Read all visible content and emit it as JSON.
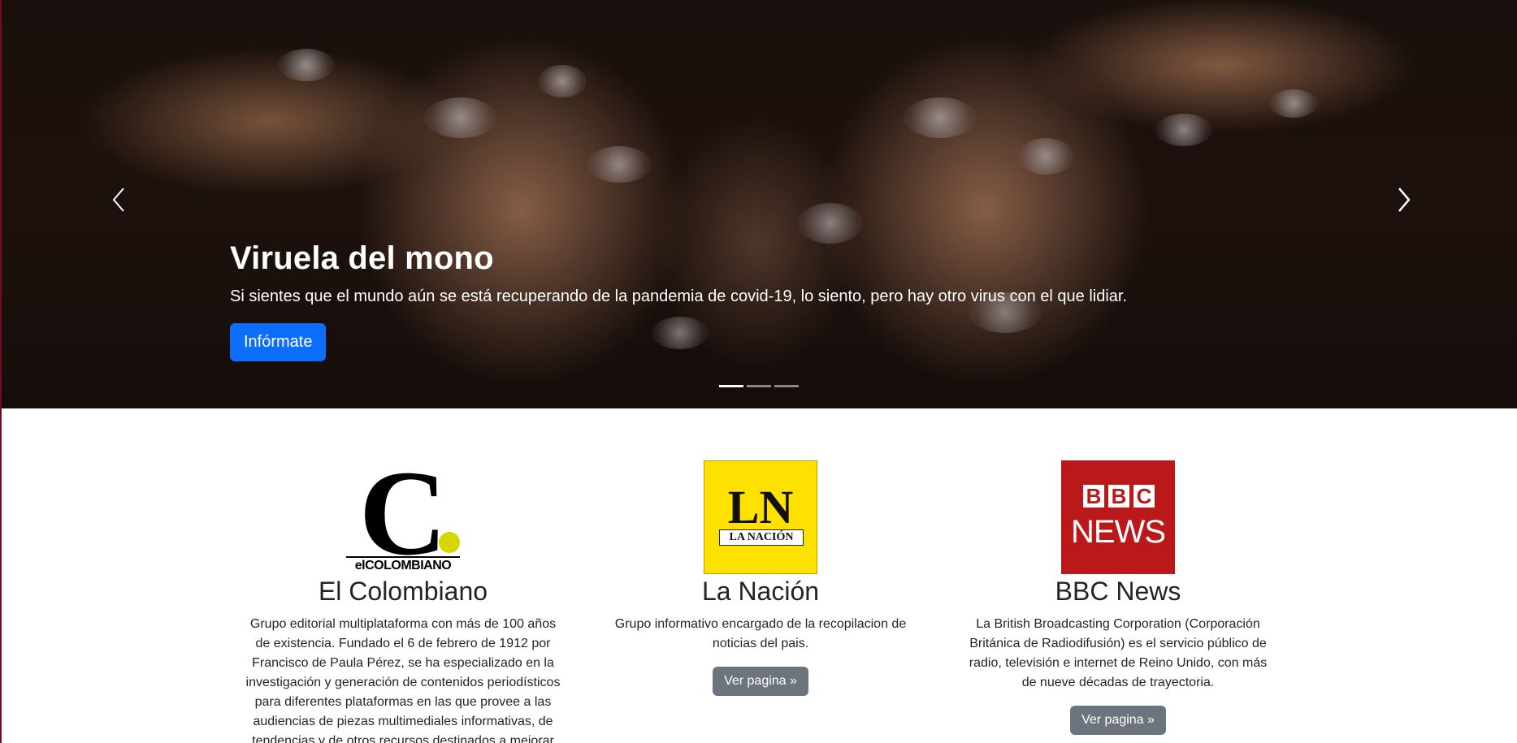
{
  "carousel": {
    "slide_title": "Viruela del mono",
    "slide_text": "Si sientes que el mundo aún se está recuperando de la pandemia de covid-19, lo siento, pero hay otro virus con el que lidiar.",
    "cta_label": "Infórmate",
    "prev_icon": "chevron-left-icon",
    "next_icon": "chevron-right-icon",
    "indicator_count": 3,
    "active_indicator": 1
  },
  "sources": [
    {
      "logo_text": "elCOLOMBIANO",
      "title": "El Colombiano",
      "description": "Grupo editorial multiplataforma con más de 100 años de existencia. Fundado el 6 de febrero de 1912 por Francisco de Paula Pérez, se ha especializado en la investigación y generación de contenidos periodísticos para diferentes plataformas en las que provee a las audiencias de piezas multimediales informativas, de tendencias y de otros recursos destinados a mejorar la"
    },
    {
      "logo_text": "LN",
      "logo_subtext": "LA NACIÓN",
      "title": "La Nación",
      "description": "Grupo informativo encargado de la recopilacion de noticias del pais.",
      "button_label": "Ver pagina »"
    },
    {
      "logo_text": "BBC",
      "logo_subtext": "NEWS",
      "title": "BBC News",
      "description": "La British Broadcasting Corporation (Corporación Británica de Radiodifusión) es el servicio público de radio, televisión e internet de Reino Unido, con más de nueve décadas de trayectoria.",
      "button_label": "Ver pagina »"
    }
  ],
  "colors": {
    "primary": "#0d6efd",
    "secondary": "#6c757d",
    "bbc_red": "#bb1919",
    "nacion_yellow": "#ffe100",
    "colombiano_dot": "#d7d600"
  }
}
